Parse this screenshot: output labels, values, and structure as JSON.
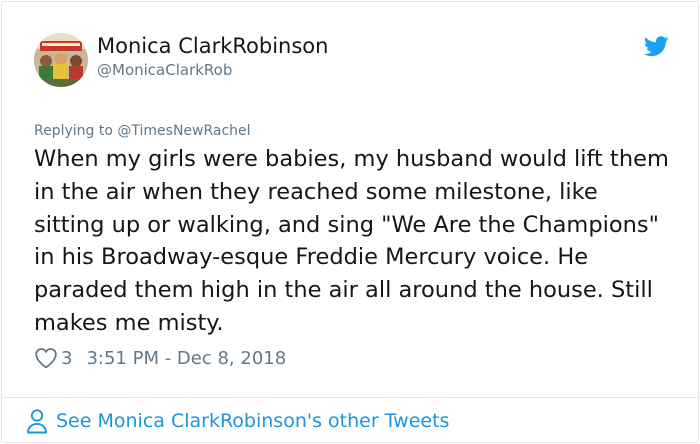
{
  "author": {
    "display_name": "Monica ClarkRobinson",
    "handle": "@MonicaClarkRob"
  },
  "reply": {
    "prefix": "Replying to ",
    "mention": "@TimesNewRachel"
  },
  "tweet": {
    "text": "When my girls were babies, my husband would lift them in the air when they reached some milestone, like sitting up or walking, and sing \"We Are the Champions\" in his Broadway-esque Freddie Mercury voice. He paraded them high in the air all around the house. Still makes me misty.",
    "like_count": "3",
    "timestamp": "3:51 PM - Dec 8, 2018"
  },
  "footer": {
    "link_label": "See Monica ClarkRobinson's other Tweets"
  },
  "icons": {
    "brand": "twitter-bird-icon",
    "like": "heart-outline-icon",
    "profile": "person-outline-icon"
  },
  "colors": {
    "twitter_blue": "#1da1f2",
    "link_blue": "#1b95e0",
    "muted_text": "#657786",
    "body_text": "#14171a",
    "border": "#e1e8ed"
  }
}
